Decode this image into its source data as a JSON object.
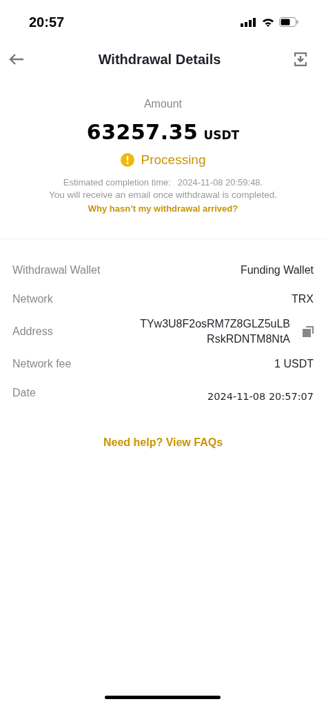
{
  "status_bar": {
    "time": "20:57"
  },
  "header": {
    "title": "Withdrawal Details"
  },
  "summary": {
    "label": "Amount",
    "amount": "63257.35",
    "currency": "USDT",
    "status": "Processing",
    "pending": true,
    "estimate_label": "Estimated completion time:",
    "estimate_time": "2024-11-08 20:59:48.",
    "notice": "You will receive an email once withdrawal is completed.",
    "help_link": "Why hasn’t my withdrawal arrived?"
  },
  "details": [
    {
      "label": "Withdrawal Wallet",
      "kind": "text",
      "value_lines": [
        "Funding Wallet"
      ]
    },
    {
      "label": "Network",
      "kind": "text",
      "value_lines": [
        "TRX"
      ]
    },
    {
      "label": "Address",
      "kind": "copy",
      "value_lines": [
        "TYw3U8F2osRM7Z8GLZ5uLB",
        "RskRDNTM8NtA"
      ]
    },
    {
      "label": "Network fee",
      "kind": "text",
      "value_lines": [
        "1 USDT"
      ]
    },
    {
      "label": "Date",
      "kind": "mono",
      "value_lines": [
        "2024-11-08 20:57:07"
      ]
    }
  ],
  "faq_link": "Need help? View FAQs"
}
